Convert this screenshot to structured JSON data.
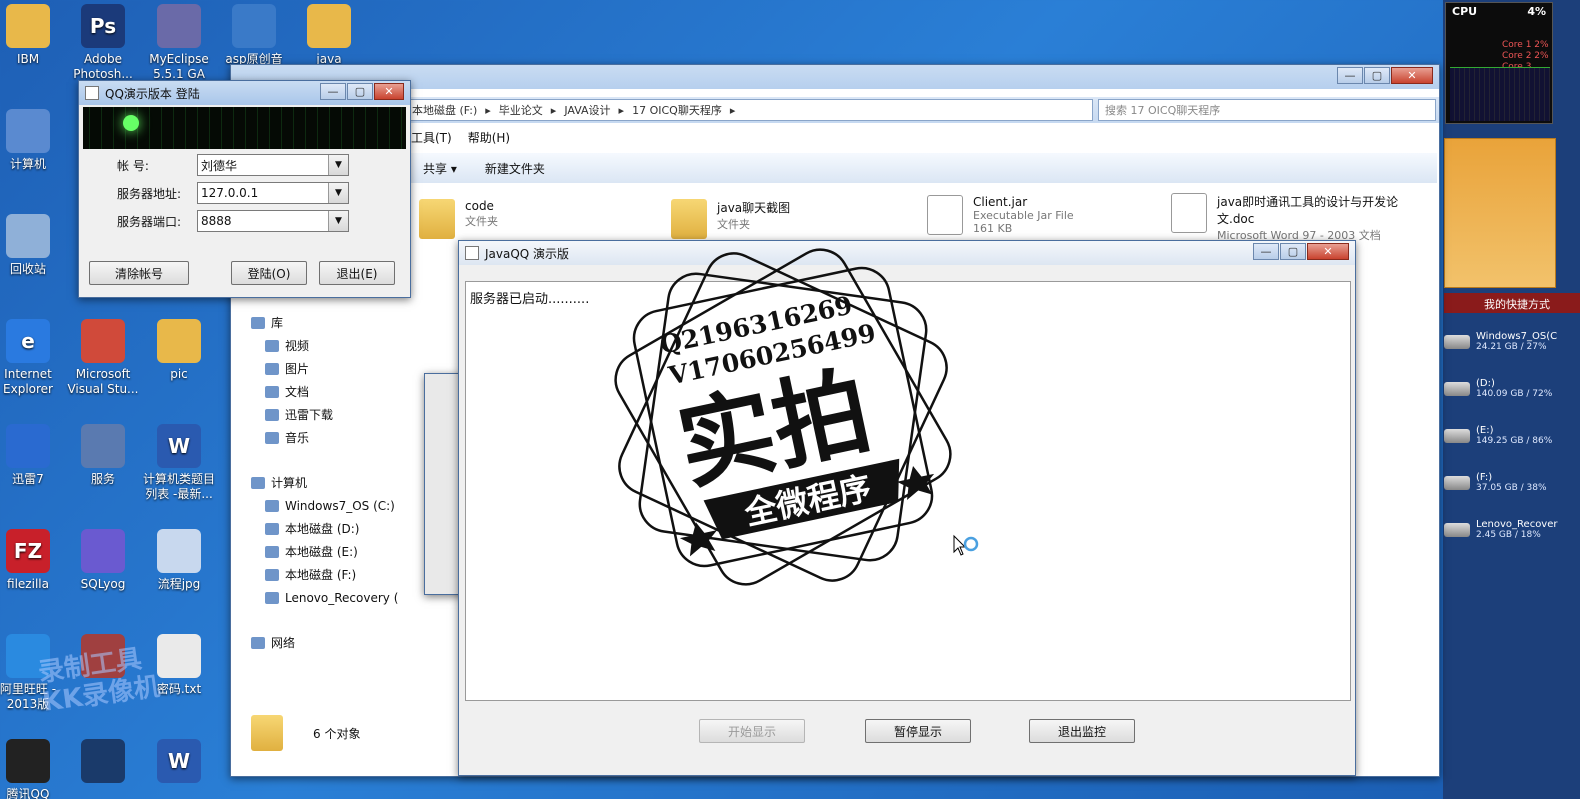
{
  "desktop": {
    "icons": [
      {
        "label": "IBM",
        "icon": "folder-icon",
        "color": "#e8b84a"
      },
      {
        "label": "Adobe Photosh...",
        "icon": "photoshop-icon",
        "color": "#1b3a7a",
        "glyph": "Ps"
      },
      {
        "label": "MyEclipse 5.5.1 GA",
        "icon": "eclipse-icon",
        "color": "#6a6aa8"
      },
      {
        "label": "asp原创音乐...",
        "icon": "media-icon",
        "color": "#3a7ac8"
      },
      {
        "label": "java",
        "icon": "folder-icon",
        "color": "#e8b84a"
      },
      {
        "label": "计算机",
        "icon": "computer-icon",
        "color": "#5a8ad0"
      },
      {
        "label": "回收站",
        "icon": "recycle-bin-icon",
        "color": "#8fb0d8"
      },
      {
        "label": "Internet Explorer",
        "icon": "ie-icon",
        "color": "#2a7ae0",
        "glyph": "e"
      },
      {
        "label": "Microsoft Visual Stu...",
        "icon": "visual-studio-icon",
        "color": "#d04a3a"
      },
      {
        "label": "pic",
        "icon": "folder-icon",
        "color": "#e8b84a"
      },
      {
        "label": "迅雷7",
        "icon": "thunder-icon",
        "color": "#2a6ad0"
      },
      {
        "label": "服务",
        "icon": "gear-icon",
        "color": "#5a7ab0"
      },
      {
        "label": "计算机类题目列表 -最新...",
        "icon": "word-doc-icon",
        "color": "#2a5ab0",
        "glyph": "W"
      },
      {
        "label": "filezilla",
        "icon": "filezilla-icon",
        "color": "#c8202a",
        "glyph": "FZ"
      },
      {
        "label": "SQLyog",
        "icon": "sqlyog-icon",
        "color": "#6a5ad0"
      },
      {
        "label": "流程jpg",
        "icon": "image-file-icon",
        "color": "#c8d8ee"
      },
      {
        "label": "阿里旺旺 - 2013版",
        "icon": "wangwang-icon",
        "color": "#2a8ae0"
      },
      {
        "label": "",
        "icon": "app-icon",
        "color": "#a04040"
      },
      {
        "label": "密码.txt",
        "icon": "text-file-icon",
        "color": "#eaeaea"
      },
      {
        "label": "腾讯QQ",
        "icon": "qq-penguin-icon",
        "color": "#222222"
      },
      {
        "label": "",
        "icon": "app-icon",
        "color": "#1a3a6a"
      },
      {
        "label": "",
        "icon": "word-doc-icon",
        "color": "#2a5ab0",
        "glyph": "W"
      }
    ],
    "recorder_watermark": "录制工具\nKK录像机"
  },
  "gadgets": {
    "cpu": {
      "title": "CPU",
      "percent": "4%",
      "cores": [
        "Core 1  2%",
        "Core 2  2%",
        "Core 3  22%"
      ]
    },
    "quick_launch_title": "我的快捷方式",
    "drives": [
      {
        "name": "Windows7_OS(C",
        "usage": "24.21 GB / 27%"
      },
      {
        "name": "(D:)",
        "usage": "140.09 GB / 72%"
      },
      {
        "name": "(E:)",
        "usage": "149.25 GB / 86%"
      },
      {
        "name": "(F:)",
        "usage": "37.05 GB / 38%"
      },
      {
        "name": "Lenovo_Recover",
        "usage": "2.45 GB / 18%"
      }
    ]
  },
  "qq_login": {
    "title": "QQ演示版本 登陆",
    "account_label": "帐      号:",
    "account_value": "刘德华",
    "server_label": "服务器地址:",
    "server_value": "127.0.0.1",
    "port_label": "服务器端口:",
    "port_value": "8888",
    "clear_button": "清除帐号",
    "login_button": "登陆(O)",
    "exit_button": "退出(E)"
  },
  "explorer": {
    "breadcrumb": [
      "本地磁盘 (F:)",
      "毕业论文",
      "JAVA设计",
      "17 OICQ聊天程序"
    ],
    "search_placeholder": "搜索 17 OICQ聊天程序",
    "menu": [
      "工具(T)",
      "帮助(H)"
    ],
    "commands": [
      "共享 ▾",
      "新建文件夹"
    ],
    "nav": {
      "libraries_title": "库",
      "libraries": [
        "视频",
        "图片",
        "文档",
        "迅雷下载",
        "音乐"
      ],
      "computer_title": "计算机",
      "drives": [
        "Windows7_OS (C:)",
        "本地磁盘 (D:)",
        "本地磁盘 (E:)",
        "本地磁盘 (F:)",
        "Lenovo_Recovery ("
      ],
      "network_title": "网络"
    },
    "files": [
      {
        "name": "code",
        "type": "文件夹",
        "icon": "folder-icon"
      },
      {
        "name": "java聊天截图",
        "type": "文件夹",
        "icon": "folder-icon"
      },
      {
        "name": "Client.jar",
        "type": "Executable Jar File",
        "size": "161 KB",
        "icon": "jar-file-icon"
      },
      {
        "name": "java即时通讯工具的设计与开发论文.doc",
        "type": "Microsoft Word 97 - 2003 文档",
        "icon": "word-doc-icon"
      }
    ],
    "status": "6 个对象"
  },
  "javaqq": {
    "title": "JavaQQ 演示版",
    "log_text": "服务器已启动..........",
    "start_button": "开始显示",
    "pause_button": "暂停显示",
    "exit_button": "退出监控"
  },
  "stamp": {
    "line1": "Q2196316269",
    "line2": "V17060256499",
    "main": "实拍",
    "banner": "全微程序",
    "color": "#111111"
  }
}
